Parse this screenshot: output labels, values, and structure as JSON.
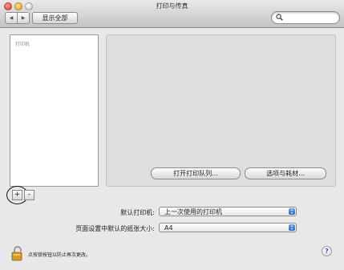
{
  "window": {
    "title": "打印与传真"
  },
  "toolbar": {
    "show_all_label": "显示全部",
    "back_icon": "◀",
    "forward_icon": "▶",
    "search_placeholder": ""
  },
  "printer_list": {
    "header": "打印机",
    "add_label": "+",
    "remove_label": "-"
  },
  "detail": {
    "open_queue_label": "打开打印队列...",
    "options_label": "选项与耗材..."
  },
  "settings": {
    "default_printer_label": "默认打印机:",
    "default_printer_value": "上一次使用的打印机",
    "paper_size_label": "页面设置中默认的纸张大小:",
    "paper_size_value": "A4"
  },
  "lock": {
    "text": "点按锁按钮以防止再次更改。"
  },
  "help": {
    "label": "?"
  }
}
